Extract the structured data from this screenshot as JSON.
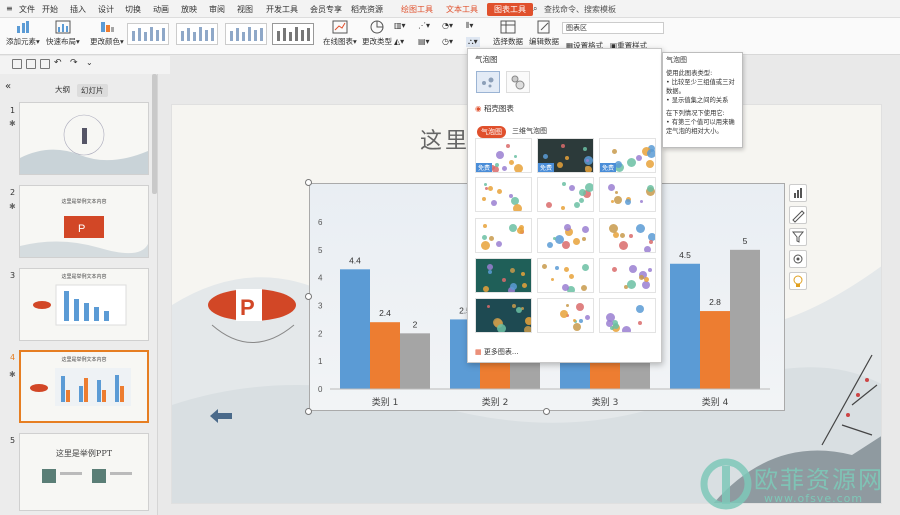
{
  "menu": {
    "file": "文件",
    "items": [
      "开始",
      "插入",
      "设计",
      "切换",
      "动画",
      "放映",
      "审阅",
      "视图",
      "开发工具",
      "会员专享",
      "稻壳资源"
    ],
    "context_tabs": [
      "绘图工具",
      "文本工具"
    ],
    "active_context": "图表工具",
    "search": "查找命令、搜索模板"
  },
  "ribbon": {
    "add_element": "添加元素",
    "quick_layout": "快速布局",
    "change_color": "更改颜色",
    "online_chart": "在线图表",
    "change_type": "更改类型",
    "select_data": "选择数据",
    "edit_data": "编辑数据",
    "area_select": "图表区",
    "set_format": "设置格式",
    "reset_style": "重置样式"
  },
  "left_panel": {
    "tab_outline": "大纲",
    "tab_slides": "幻灯片",
    "slides": [
      {
        "num": "1",
        "text": ""
      },
      {
        "num": "2",
        "text": "这里是举例文本内容"
      },
      {
        "num": "3",
        "text": "这里是举例文本内容"
      },
      {
        "num": "4",
        "text": "这里是举例文本内容"
      },
      {
        "num": "5",
        "text": "这里是举例PPT"
      }
    ]
  },
  "slide": {
    "title": "这里是"
  },
  "chart_data": {
    "type": "bar",
    "categories": [
      "类别 1",
      "类别 2",
      "类别 3",
      "类别 4"
    ],
    "series": [
      {
        "values": [
          4.3,
          2.5,
          3.5,
          4.5
        ],
        "color": "#5b9bd5"
      },
      {
        "values": [
          2.4,
          4.4,
          1.8,
          2.8
        ],
        "color": "#ed7d31"
      },
      {
        "values": [
          2,
          2,
          3,
          5
        ],
        "color": "#a5a5a5"
      }
    ],
    "data_labels": {
      "series_0": [
        "4.4",
        "2.5",
        "",
        "4.5"
      ],
      "series_1": [
        "2.4",
        "",
        "",
        "2.8"
      ],
      "series_2": [
        "2",
        "",
        "",
        "5"
      ]
    },
    "yticks": [
      "0",
      "1",
      "2",
      "3",
      "4",
      "5",
      "6"
    ],
    "ylim": [
      0,
      6
    ]
  },
  "dropdown": {
    "title": "气泡图",
    "section_title": "稻壳图表",
    "tab_bubble": "气泡图",
    "tab_3d": "三维气泡图",
    "free_label": "免费",
    "more": "更多图表..."
  },
  "tooltip": {
    "title": "气泡图",
    "lines": [
      "使用此图表类型:",
      "• 比较至少三组值或三对数据。",
      "• 显示值集之间的关系",
      "",
      "在下列情况下使用它:",
      "• 有第三个值可以用来确定气泡的相对大小。"
    ]
  },
  "watermark": {
    "text": "欧菲资源网",
    "url": "www.ofsve.com"
  }
}
